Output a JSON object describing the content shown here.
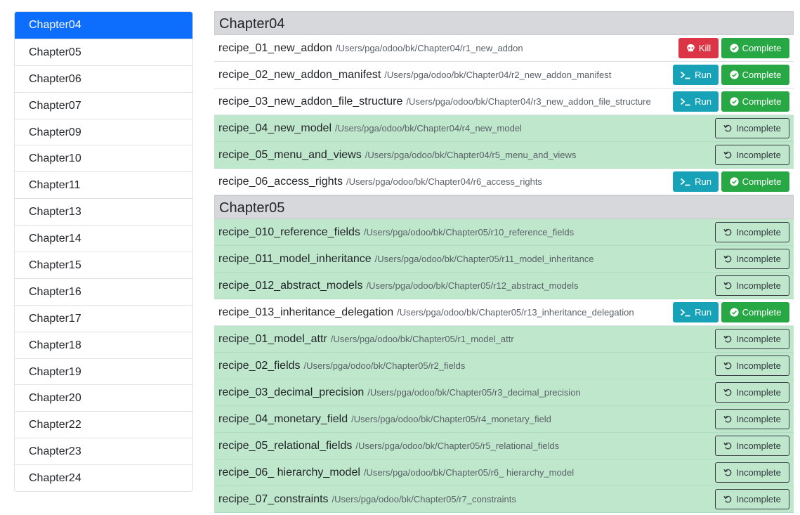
{
  "sidebar": {
    "items": [
      "Chapter04",
      "Chapter05",
      "Chapter06",
      "Chapter07",
      "Chapter09",
      "Chapter10",
      "Chapter11",
      "Chapter13",
      "Chapter14",
      "Chapter15",
      "Chapter16",
      "Chapter17",
      "Chapter18",
      "Chapter19",
      "Chapter20",
      "Chapter22",
      "Chapter23",
      "Chapter24"
    ],
    "active_index": 0
  },
  "labels": {
    "kill": "Kill",
    "run": "Run",
    "complete": "Complete",
    "incomplete": "Incomplete"
  },
  "colors": {
    "active": "#0d6efd",
    "done_row": "#bfe7cc",
    "kill": "#dc3545",
    "run": "#17a2b8",
    "complete": "#28a745"
  },
  "chapters": [
    {
      "title": "Chapter04",
      "recipes": [
        {
          "name": "recipe_01_new_addon",
          "path": "/Users/pga/odoo/bk/Chapter04/r1_new_addon",
          "status": "running"
        },
        {
          "name": "recipe_02_new_addon_manifest",
          "path": "/Users/pga/odoo/bk/Chapter04/r2_new_addon_manifest",
          "status": "todo"
        },
        {
          "name": "recipe_03_new_addon_file_structure",
          "path": "/Users/pga/odoo/bk/Chapter04/r3_new_addon_file_structure",
          "status": "todo"
        },
        {
          "name": "recipe_04_new_model",
          "path": "/Users/pga/odoo/bk/Chapter04/r4_new_model",
          "status": "done"
        },
        {
          "name": "recipe_05_menu_and_views",
          "path": "/Users/pga/odoo/bk/Chapter04/r5_menu_and_views",
          "status": "done"
        },
        {
          "name": "recipe_06_access_rights",
          "path": "/Users/pga/odoo/bk/Chapter04/r6_access_rights",
          "status": "todo"
        }
      ]
    },
    {
      "title": "Chapter05",
      "recipes": [
        {
          "name": "recipe_010_reference_fields",
          "path": "/Users/pga/odoo/bk/Chapter05/r10_reference_fields",
          "status": "done"
        },
        {
          "name": "recipe_011_model_inheritance",
          "path": "/Users/pga/odoo/bk/Chapter05/r11_model_inheritance",
          "status": "done"
        },
        {
          "name": "recipe_012_abstract_models",
          "path": "/Users/pga/odoo/bk/Chapter05/r12_abstract_models",
          "status": "done"
        },
        {
          "name": "recipe_013_inheritance_delegation",
          "path": "/Users/pga/odoo/bk/Chapter05/r13_inheritance_delegation",
          "status": "todo"
        },
        {
          "name": "recipe_01_model_attr",
          "path": "/Users/pga/odoo/bk/Chapter05/r1_model_attr",
          "status": "done"
        },
        {
          "name": "recipe_02_fields",
          "path": "/Users/pga/odoo/bk/Chapter05/r2_fields",
          "status": "done"
        },
        {
          "name": "recipe_03_decimal_precision",
          "path": "/Users/pga/odoo/bk/Chapter05/r3_decimal_precision",
          "status": "done"
        },
        {
          "name": "recipe_04_monetary_field",
          "path": "/Users/pga/odoo/bk/Chapter05/r4_monetary_field",
          "status": "done"
        },
        {
          "name": "recipe_05_relational_fields",
          "path": "/Users/pga/odoo/bk/Chapter05/r5_relational_fields",
          "status": "done"
        },
        {
          "name": "recipe_06_ hierarchy_model",
          "path": "/Users/pga/odoo/bk/Chapter05/r6_ hierarchy_model",
          "status": "done"
        },
        {
          "name": "recipe_07_constraints",
          "path": "/Users/pga/odoo/bk/Chapter05/r7_constraints",
          "status": "done"
        }
      ]
    }
  ]
}
